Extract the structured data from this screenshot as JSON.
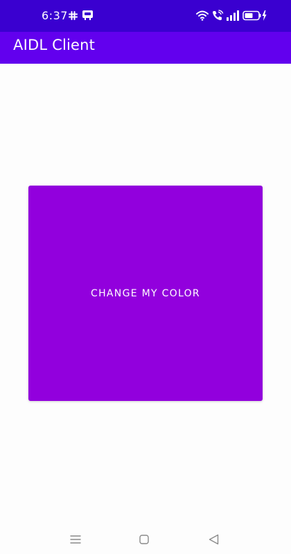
{
  "status_bar": {
    "time": "6:37",
    "icons": [
      "slack-icon",
      "notification-icon",
      "wifi-icon",
      "wifi-calling-icon",
      "signal-icon",
      "battery-charging-icon"
    ]
  },
  "app_bar": {
    "title": "AIDL Client"
  },
  "main": {
    "button_label": "CHANGE MY COLOR"
  },
  "nav_bar": {
    "icons": [
      "menu-icon",
      "home-icon",
      "back-icon"
    ]
  },
  "colors": {
    "status_bar": "#3a00d0",
    "app_bar": "#6200ee",
    "button": "#9200dd",
    "background": "#fdfdfd",
    "nav_icons": "#8a8a8a"
  }
}
